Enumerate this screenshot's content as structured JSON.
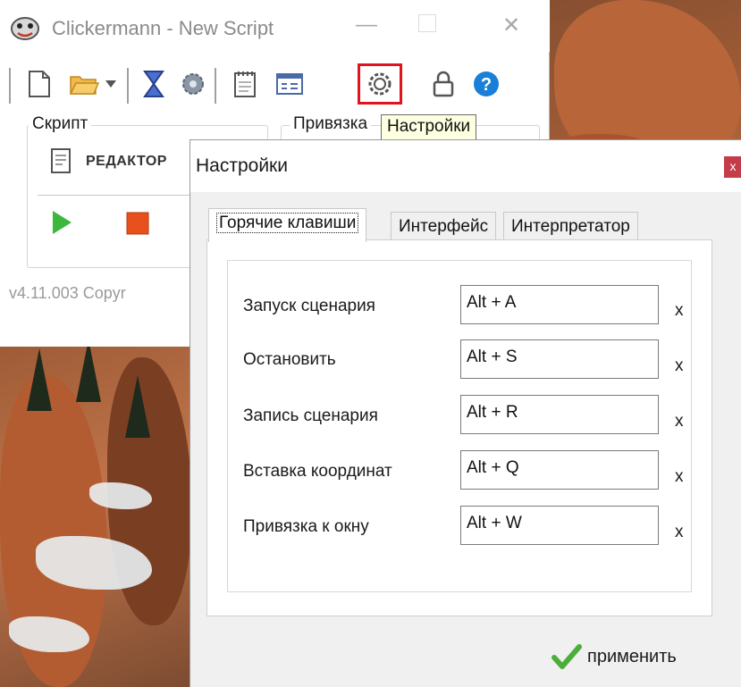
{
  "app": {
    "title": "Clickermann - New Script",
    "version_text": "v4.11.003   Copyr"
  },
  "groups": {
    "script_label": "Скрипт",
    "binding_label": "Привязка",
    "editor_label": "РЕДАКТОР"
  },
  "tooltip": {
    "text": "Настройки"
  },
  "toolbar": {
    "icons": [
      "new-document-icon",
      "open-folder-icon",
      "dropdown-arrow-icon",
      "hourglass-icon",
      "gear-small-icon",
      "notepad-icon",
      "window-icon",
      "settings-gear-icon",
      "lock-icon",
      "help-icon"
    ],
    "highlighted": "settings-gear-icon"
  },
  "dialog": {
    "title": "Настройки",
    "close_label": "x",
    "tabs": [
      "Горячие клавиши",
      "Интерфейс",
      "Интерпретатор"
    ],
    "active_tab": "Горячие клавиши",
    "rows": [
      {
        "label": "Запуск сценария",
        "value": "Alt + A",
        "clear": "x"
      },
      {
        "label": "Остановить",
        "value": "Alt + S",
        "clear": "x"
      },
      {
        "label": "Запись сценария",
        "value": "Alt + R",
        "clear": "x"
      },
      {
        "label": "Вставка координат",
        "value": "Alt + Q",
        "clear": "x"
      },
      {
        "label": "Привязка к окну",
        "value": "Alt + W",
        "clear": "x"
      }
    ],
    "apply_label": "применить"
  },
  "colors": {
    "highlight": "#e0141e",
    "play": "#3cb83c",
    "stop": "#e8501e",
    "apply_check": "#4cae3a",
    "help": "#1a7fd8"
  }
}
